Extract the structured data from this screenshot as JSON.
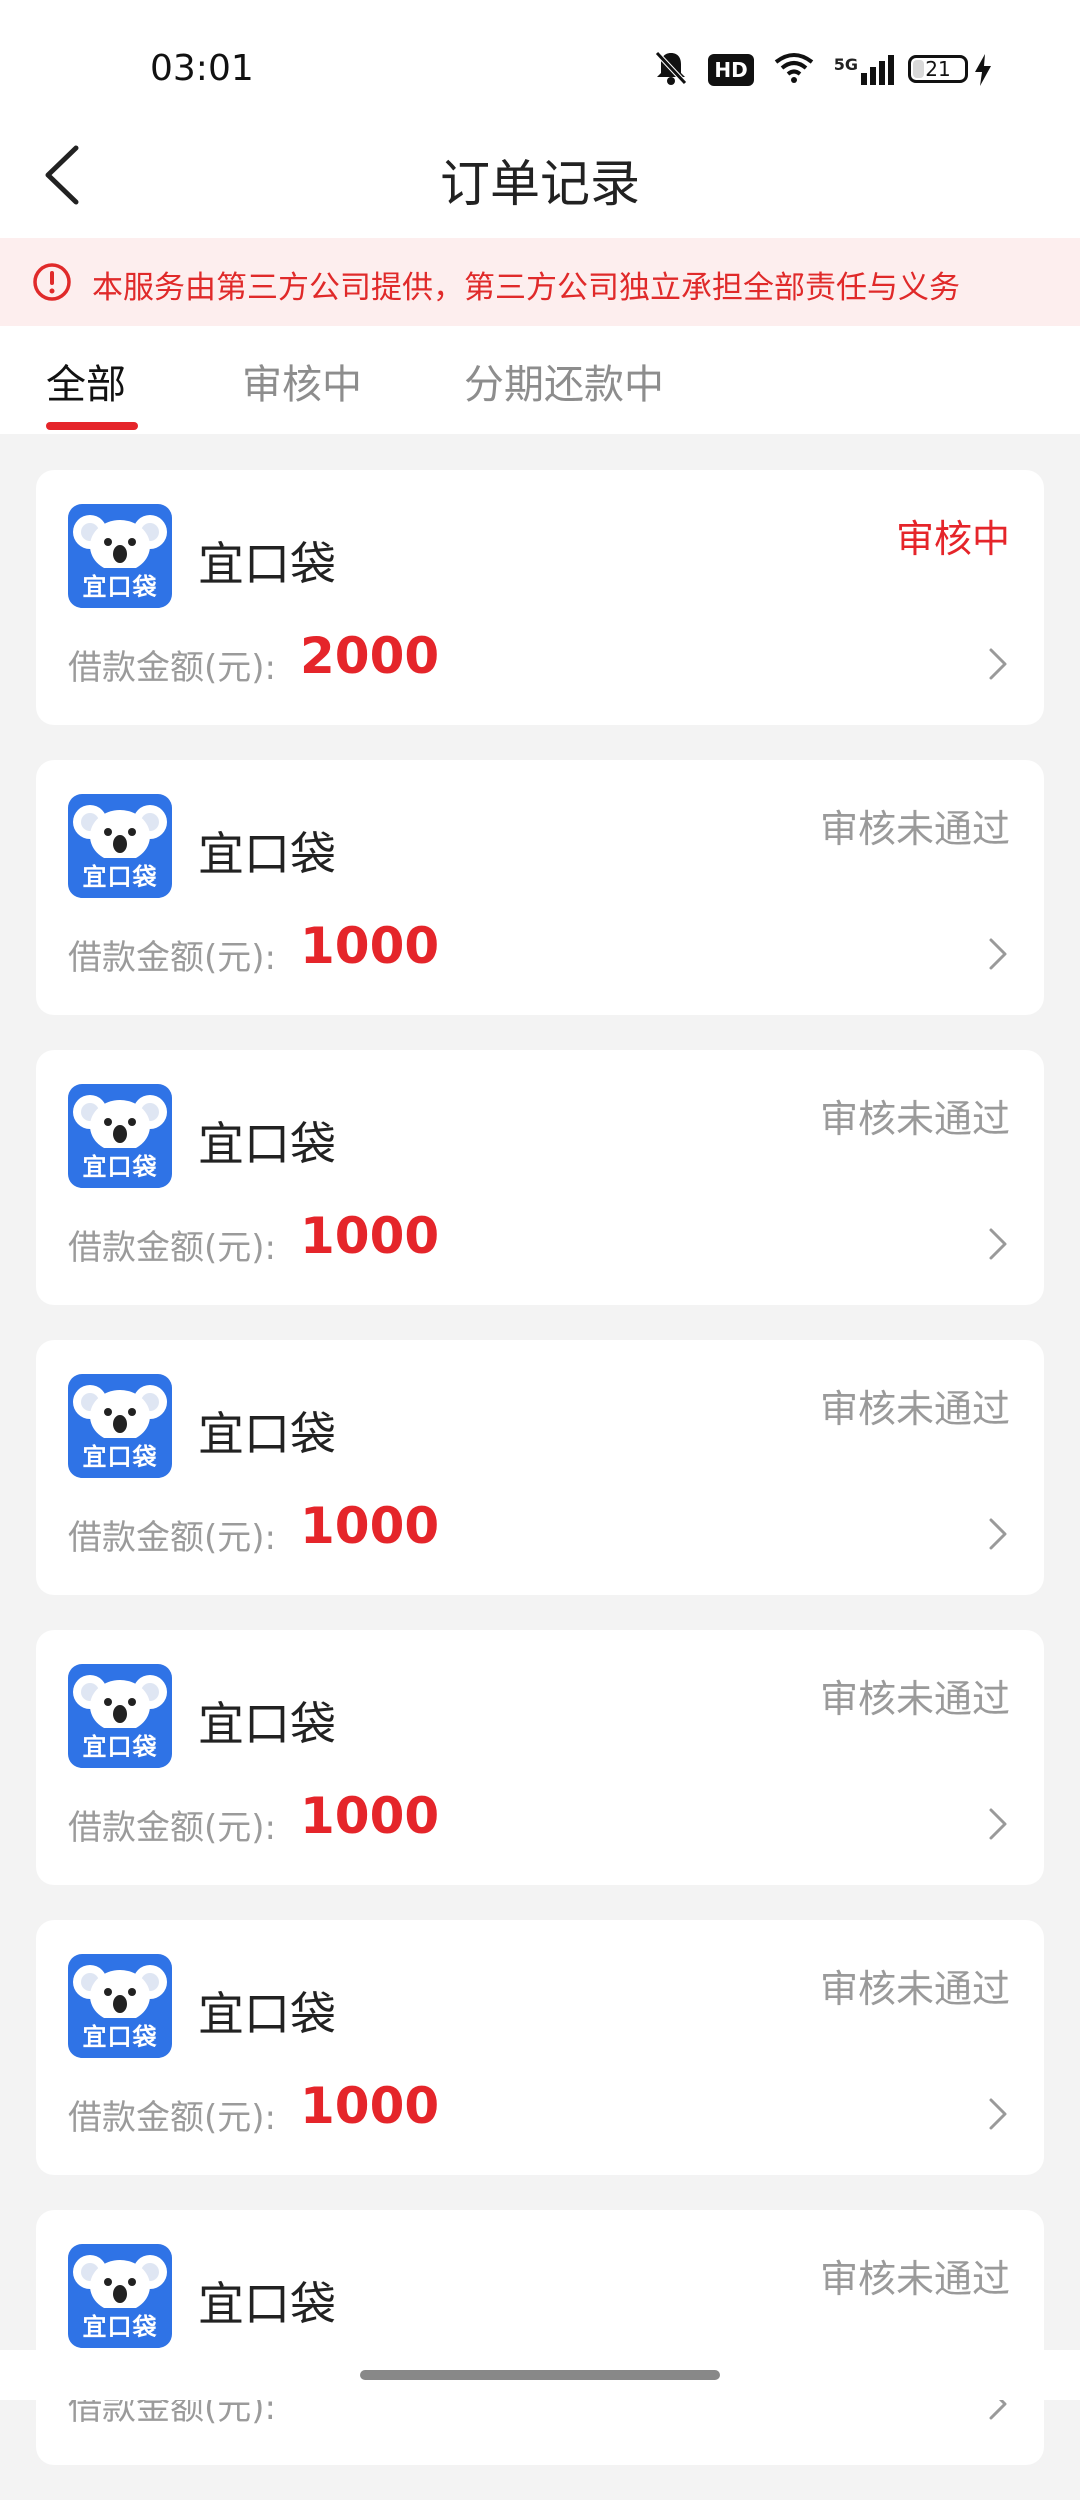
{
  "status_bar": {
    "time": "03:01",
    "hd": "HD",
    "network": "5G",
    "battery_level": 21
  },
  "header": {
    "title": "订单记录"
  },
  "notice": {
    "text": "本服务由第三方公司提供，第三方公司独立承担全部责任与义务",
    "color": "#e02a2a"
  },
  "tabs": [
    {
      "label": "全部",
      "active": true
    },
    {
      "label": "审核中",
      "active": false
    },
    {
      "label": "分期还款中",
      "active": false
    }
  ],
  "orders": [
    {
      "app_name": "宜口袋",
      "logo_text": "宜口袋",
      "status": "审核中",
      "amount_label": "借款金额(元):",
      "amount": "2000"
    },
    {
      "app_name": "宜口袋",
      "logo_text": "宜口袋",
      "status": "审核未通过",
      "amount_label": "借款金额(元):",
      "amount": "1000"
    },
    {
      "app_name": "宜口袋",
      "logo_text": "宜口袋",
      "status": "审核未通过",
      "amount_label": "借款金额(元):",
      "amount": "1000"
    },
    {
      "app_name": "宜口袋",
      "logo_text": "宜口袋",
      "status": "审核未通过",
      "amount_label": "借款金额(元):",
      "amount": "1000"
    },
    {
      "app_name": "宜口袋",
      "logo_text": "宜口袋",
      "status": "审核未通过",
      "amount_label": "借款金额(元):",
      "amount": "1000"
    },
    {
      "app_name": "宜口袋",
      "logo_text": "宜口袋",
      "status": "审核未通过",
      "amount_label": "借款金额(元):",
      "amount": "1000"
    },
    {
      "app_name": "宜口袋",
      "logo_text": "宜口袋",
      "status": "审核未通过",
      "amount_label": "借款金额(元):",
      "amount": ""
    }
  ],
  "colors": {
    "accent": "#e5252a",
    "logo_blue": "#2f73e6"
  }
}
